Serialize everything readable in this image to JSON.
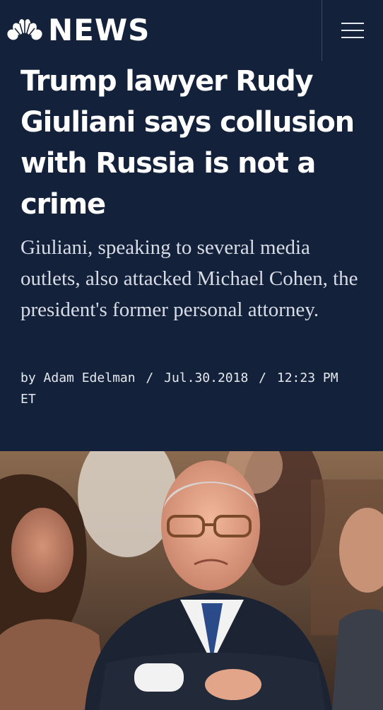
{
  "header": {
    "logo_text": "NEWS",
    "logo_icon": "peacock-icon",
    "menu_icon": "hamburger-menu-icon"
  },
  "article": {
    "headline": "Trump lawyer Rudy Giuliani says collusion with Russia is not a crime",
    "dek": "Giuliani, speaking to several media outlets, also attacked Michael Cohen, the president's former personal attorney.",
    "byline": {
      "prefix": "by",
      "author": "Adam Edelman",
      "separator": "/",
      "date": "Jul.30.2018",
      "time": "12:23 PM ET"
    }
  },
  "colors": {
    "background": "#14213a",
    "headline": "#ffffff",
    "dek": "#d7dce6"
  }
}
